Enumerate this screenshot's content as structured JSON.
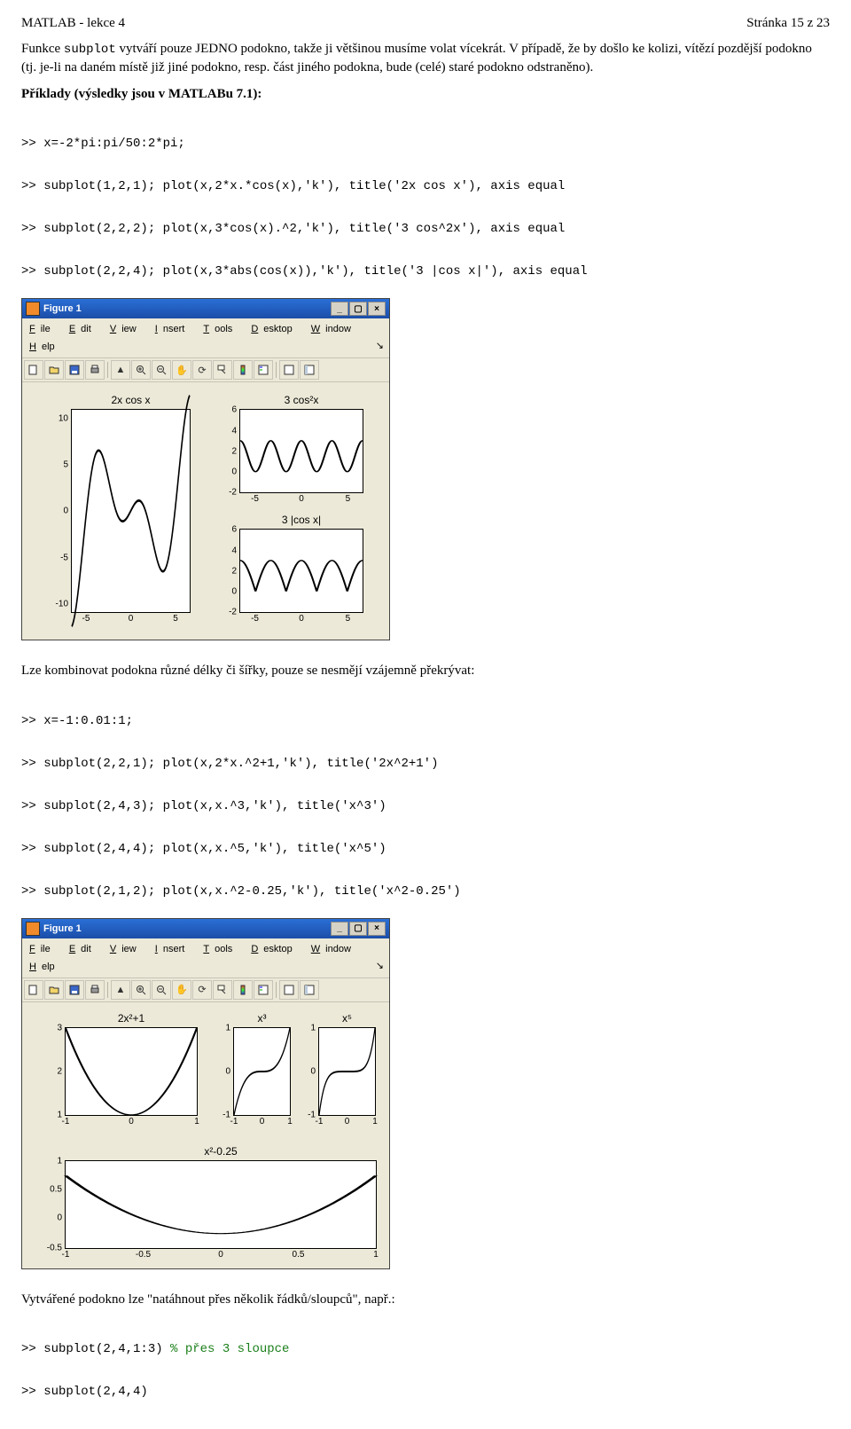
{
  "header": {
    "left": "MATLAB - lekce 4",
    "right": "Stránka 15 z 23"
  },
  "p1_pre": "Funkce ",
  "p1_code": "subplot",
  "p1_post": " vytváří pouze JEDNO podokno, takže ji většinou musíme volat vícekrát. V případě, že by došlo ke kolizi, vítězí pozdější podokno (tj. je-li na daném místě již jiné podokno, resp. část jiného podokna, bude (celé) staré podokno odstraněno).",
  "p2": "Příklady (výsledky jsou v MATLABu 7.1):",
  "code1": [
    ">> x=-2*pi:pi/50:2*pi;",
    ">> subplot(1,2,1); plot(x,2*x.*cos(x),'k'), title('2x cos x'), axis equal",
    ">> subplot(2,2,2); plot(x,3*cos(x).^2,'k'), title('3 cos^2x'), axis equal",
    ">> subplot(2,2,4); plot(x,3*abs(cos(x)),'k'), title('3 |cos x|'), axis equal"
  ],
  "p3": "Lze kombinovat podokna různé délky či šířky, pouze se nesmějí vzájemně překrývat:",
  "code2": [
    ">> x=-1:0.01:1;",
    ">> subplot(2,2,1); plot(x,2*x.^2+1,'k'), title('2x^2+1')",
    ">> subplot(2,4,3); plot(x,x.^3,'k'), title('x^3')",
    ">> subplot(2,4,4); plot(x,x.^5,'k'), title('x^5')",
    ">> subplot(2,1,2); plot(x,x.^2-0.25,'k'), title('x^2-0.25')"
  ],
  "p4": "Vytvářené podokno lze \"natáhnout přes několik řádků/sloupců\", např.:",
  "code3": [
    {
      "t": ">> subplot(2,4,1:3) ",
      "c": "% přes 3 sloupce"
    },
    {
      "t": ">> subplot(2,4,4)",
      "c": ""
    }
  ],
  "fig1": {
    "title": "Figure 1",
    "menus": [
      "File",
      "Edit",
      "View",
      "Insert",
      "Tools",
      "Desktop",
      "Window",
      "Help"
    ],
    "axes": [
      {
        "title": "2x cos x",
        "yticks": [
          "10",
          "5",
          "0",
          "-5",
          "-10"
        ],
        "xticks": [
          "-5",
          "0",
          "5"
        ]
      },
      {
        "title": "3 cos²x",
        "yticks": [
          "6",
          "4",
          "2",
          "0",
          "-2"
        ],
        "xticks": [
          "-5",
          "0",
          "5"
        ]
      },
      {
        "title": "3 |cos x|",
        "yticks": [
          "6",
          "4",
          "2",
          "0",
          "-2"
        ],
        "xticks": [
          "-5",
          "0",
          "5"
        ]
      }
    ]
  },
  "fig2": {
    "title": "Figure 1",
    "menus": [
      "File",
      "Edit",
      "View",
      "Insert",
      "Tools",
      "Desktop",
      "Window",
      "Help"
    ],
    "axes": [
      {
        "title": "2x²+1",
        "yticks": [
          "3",
          "2",
          "1"
        ],
        "xticks": [
          "-1",
          "0",
          "1"
        ]
      },
      {
        "title": "x³",
        "yticks": [
          "1",
          "0",
          "-1"
        ],
        "xticks": [
          "-1",
          "0",
          "1"
        ]
      },
      {
        "title": "x⁵",
        "yticks": [
          "1",
          "0",
          "-1"
        ],
        "xticks": [
          "-1",
          "0",
          "1"
        ]
      },
      {
        "title": "x²-0.25",
        "yticks": [
          "1",
          "0.5",
          "0",
          "-0.5"
        ],
        "xticks": [
          "-1",
          "-0.5",
          "0",
          "0.5",
          "1"
        ]
      }
    ]
  },
  "chart_data": [
    {
      "type": "line",
      "title": "2x cos x",
      "x_range": [
        -6.283,
        6.283
      ],
      "y_range": [
        -12,
        12
      ],
      "formula": "y = 2*x*cos(x)",
      "xticks": [
        -5,
        0,
        5
      ],
      "yticks": [
        -10,
        -5,
        0,
        5,
        10
      ]
    },
    {
      "type": "line",
      "title": "3 cos^2 x",
      "x_range": [
        -6.283,
        6.283
      ],
      "y_range": [
        -2,
        6
      ],
      "formula": "y = 3*cos(x)^2",
      "xticks": [
        -5,
        0,
        5
      ],
      "yticks": [
        -2,
        0,
        2,
        4,
        6
      ]
    },
    {
      "type": "line",
      "title": "3 |cos x|",
      "x_range": [
        -6.283,
        6.283
      ],
      "y_range": [
        -2,
        6
      ],
      "formula": "y = 3*|cos(x)|",
      "xticks": [
        -5,
        0,
        5
      ],
      "yticks": [
        -2,
        0,
        2,
        4,
        6
      ]
    },
    {
      "type": "line",
      "title": "2x^2+1",
      "x_range": [
        -1,
        1
      ],
      "y_range": [
        1,
        3
      ],
      "formula": "y = 2*x^2 + 1",
      "xticks": [
        -1,
        0,
        1
      ],
      "yticks": [
        1,
        2,
        3
      ]
    },
    {
      "type": "line",
      "title": "x^3",
      "x_range": [
        -1,
        1
      ],
      "y_range": [
        -1,
        1
      ],
      "formula": "y = x^3",
      "xticks": [
        -1,
        0,
        1
      ],
      "yticks": [
        -1,
        0,
        1
      ]
    },
    {
      "type": "line",
      "title": "x^5",
      "x_range": [
        -1,
        1
      ],
      "y_range": [
        -1,
        1
      ],
      "formula": "y = x^5",
      "xticks": [
        -1,
        0,
        1
      ],
      "yticks": [
        -1,
        0,
        1
      ]
    },
    {
      "type": "line",
      "title": "x^2-0.25",
      "x_range": [
        -1,
        1
      ],
      "y_range": [
        -0.5,
        1
      ],
      "formula": "y = x^2 - 0.25",
      "xticks": [
        -1,
        -0.5,
        0,
        0.5,
        1
      ],
      "yticks": [
        -0.5,
        0,
        0.5,
        1
      ]
    }
  ]
}
